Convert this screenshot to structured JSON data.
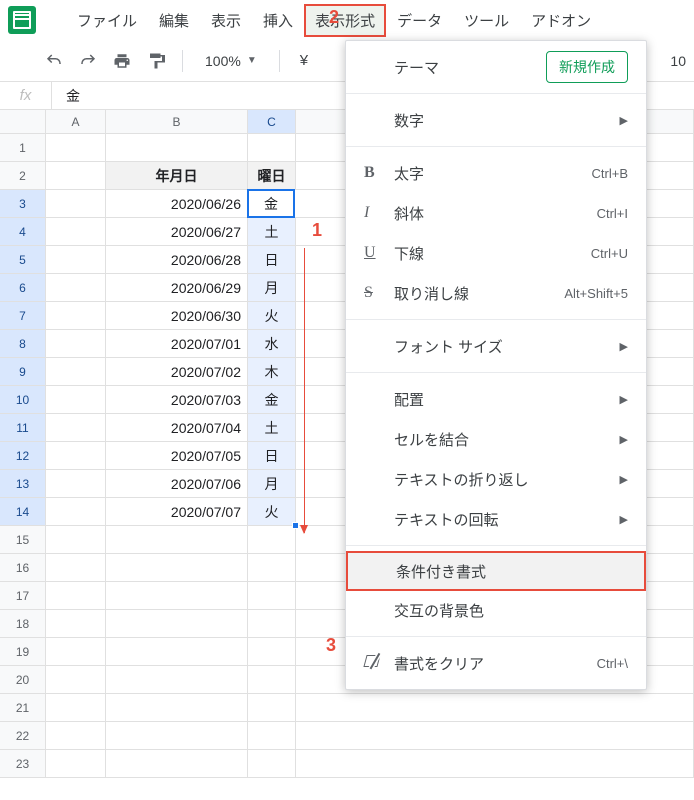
{
  "menubar": {
    "items": [
      "ファイル",
      "編集",
      "表示",
      "挿入",
      "表示形式",
      "データ",
      "ツール",
      "アドオン"
    ],
    "active_index": 4
  },
  "toolbar": {
    "zoom": "100%",
    "currency": "¥",
    "font_size": "10"
  },
  "formula_bar": {
    "fx": "fx",
    "value": "金"
  },
  "columns": [
    "A",
    "B",
    "C"
  ],
  "header_row": {
    "b": "年月日",
    "c": "曜日"
  },
  "data_rows": [
    {
      "num": "3",
      "b": "2020/06/26",
      "c": "金"
    },
    {
      "num": "4",
      "b": "2020/06/27",
      "c": "土"
    },
    {
      "num": "5",
      "b": "2020/06/28",
      "c": "日"
    },
    {
      "num": "6",
      "b": "2020/06/29",
      "c": "月"
    },
    {
      "num": "7",
      "b": "2020/06/30",
      "c": "火"
    },
    {
      "num": "8",
      "b": "2020/07/01",
      "c": "水"
    },
    {
      "num": "9",
      "b": "2020/07/02",
      "c": "木"
    },
    {
      "num": "10",
      "b": "2020/07/03",
      "c": "金"
    },
    {
      "num": "11",
      "b": "2020/07/04",
      "c": "土"
    },
    {
      "num": "12",
      "b": "2020/07/05",
      "c": "日"
    },
    {
      "num": "13",
      "b": "2020/07/06",
      "c": "月"
    },
    {
      "num": "14",
      "b": "2020/07/07",
      "c": "火"
    }
  ],
  "empty_top": {
    "num": "1"
  },
  "header_num": {
    "num": "2"
  },
  "empty_rows": [
    "15",
    "16",
    "17",
    "18",
    "19",
    "20",
    "21",
    "22",
    "23"
  ],
  "dropdown": {
    "theme": "テーマ",
    "new_btn": "新規作成",
    "number": "数字",
    "bold": {
      "label": "太字",
      "shortcut": "Ctrl+B"
    },
    "italic": {
      "label": "斜体",
      "shortcut": "Ctrl+I"
    },
    "underline": {
      "label": "下線",
      "shortcut": "Ctrl+U"
    },
    "strike": {
      "label": "取り消し線",
      "shortcut": "Alt+Shift+5"
    },
    "fontsize": "フォント サイズ",
    "align": "配置",
    "merge": "セルを結合",
    "wrap": "テキストの折り返し",
    "rotate": "テキストの回転",
    "conditional": "条件付き書式",
    "alternating": "交互の背景色",
    "clear": {
      "label": "書式をクリア",
      "shortcut": "Ctrl+\\"
    }
  },
  "annotations": {
    "a1": "1",
    "a2": "2",
    "a3": "3"
  }
}
